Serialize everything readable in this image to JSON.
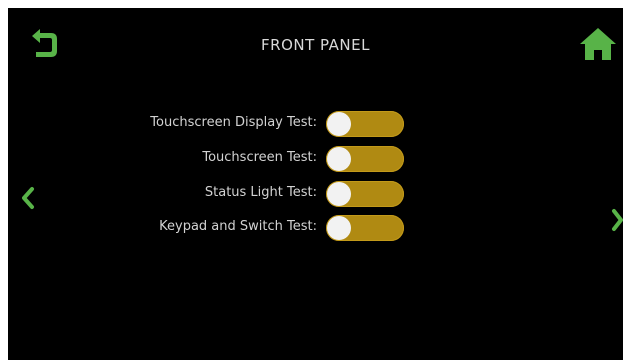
{
  "header": {
    "title": "FRONT PANEL",
    "back_icon": "back-arrow-icon",
    "home_icon": "home-icon"
  },
  "navigation": {
    "prev_icon": "chevron-left-icon",
    "next_icon": "chevron-right-icon"
  },
  "tests": [
    {
      "label": "Touchscreen Display Test:",
      "state": "off"
    },
    {
      "label": "Touchscreen Test:",
      "state": "off"
    },
    {
      "label": "Status Light Test:",
      "state": "off"
    },
    {
      "label": "Keypad and Switch Test:",
      "state": "off"
    }
  ],
  "colors": {
    "background": "#000000",
    "accent_green": "#58b348",
    "toggle_track": "#b08a12",
    "toggle_knob": "#f2f2f2",
    "text": "#d2d2d2"
  }
}
